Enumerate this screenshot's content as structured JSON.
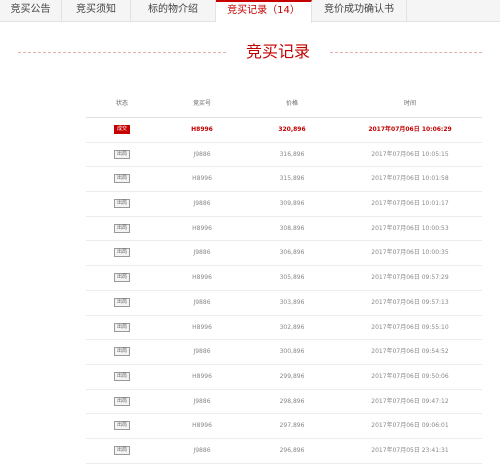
{
  "tabs": [
    {
      "label": "竞买公告"
    },
    {
      "label": "竞买须知"
    },
    {
      "label": "标的物介绍"
    },
    {
      "label": "竞买记录（14）"
    },
    {
      "label": "竞价成功确认书"
    }
  ],
  "section_title": "竞买记录",
  "table": {
    "headers": [
      "状态",
      "竞买号",
      "价格",
      "时间"
    ],
    "rows": [
      {
        "status": "成交",
        "bidder": "H8996",
        "price": "320,896",
        "time": "2017年07月06日 10:06:29"
      },
      {
        "status": "出局",
        "bidder": "J9886",
        "price": "316,896",
        "time": "2017年07月06日 10:05:15"
      },
      {
        "status": "出局",
        "bidder": "H8996",
        "price": "315,896",
        "time": "2017年07月06日 10:01:58"
      },
      {
        "status": "出局",
        "bidder": "J9886",
        "price": "309,896",
        "time": "2017年07月06日 10:01:17"
      },
      {
        "status": "出局",
        "bidder": "H8996",
        "price": "308,896",
        "time": "2017年07月06日 10:00:53"
      },
      {
        "status": "出局",
        "bidder": "J9886",
        "price": "306,896",
        "time": "2017年07月06日 10:00:35"
      },
      {
        "status": "出局",
        "bidder": "H8996",
        "price": "305,896",
        "time": "2017年07月06日 09:57:29"
      },
      {
        "status": "出局",
        "bidder": "J9886",
        "price": "303,896",
        "time": "2017年07月06日 09:57:13"
      },
      {
        "status": "出局",
        "bidder": "H8996",
        "price": "302,896",
        "time": "2017年07月06日 09:55:10"
      },
      {
        "status": "出局",
        "bidder": "J9886",
        "price": "300,896",
        "time": "2017年07月06日 09:54:52"
      },
      {
        "status": "出局",
        "bidder": "H8996",
        "price": "299,896",
        "time": "2017年07月06日 09:50:06"
      },
      {
        "status": "出局",
        "bidder": "J9886",
        "price": "298,896",
        "time": "2017年07月06日 09:47:12"
      },
      {
        "status": "出局",
        "bidder": "H8996",
        "price": "297,896",
        "time": "2017年07月06日 09:06:01"
      },
      {
        "status": "出局",
        "bidder": "J9886",
        "price": "296,896",
        "time": "2017年07月05日 23:41:31"
      }
    ]
  },
  "colors": {
    "accent": "#c40000",
    "tab_bg": "#f5f5f5",
    "border": "#e2e2e2"
  }
}
